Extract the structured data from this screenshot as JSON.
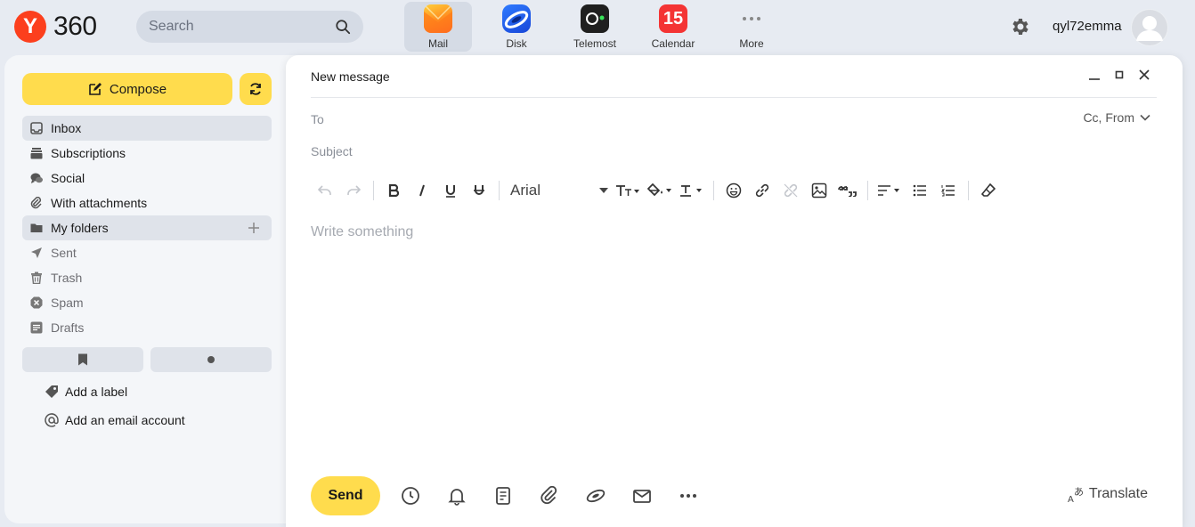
{
  "brand": {
    "logo_letter": "Y",
    "logo_text": "360"
  },
  "search": {
    "placeholder": "Search"
  },
  "apps": [
    {
      "label": "Mail"
    },
    {
      "label": "Disk"
    },
    {
      "label": "Telemost"
    },
    {
      "label": "Calendar",
      "badge": "15"
    },
    {
      "label": "More"
    }
  ],
  "user": {
    "name": "qyl72emma"
  },
  "sidebar": {
    "compose_label": "Compose",
    "folders": [
      {
        "label": "Inbox"
      },
      {
        "label": "Subscriptions"
      },
      {
        "label": "Social"
      },
      {
        "label": "With attachments"
      },
      {
        "label": "My folders"
      },
      {
        "label": "Sent"
      },
      {
        "label": "Trash"
      },
      {
        "label": "Spam"
      },
      {
        "label": "Drafts"
      }
    ],
    "add_label": "Add a label",
    "add_account": "Add an email account"
  },
  "compose": {
    "title": "New message",
    "to_placeholder": "To",
    "cc_from": "Cc, From",
    "subject_placeholder": "Subject",
    "font": "Arial",
    "body_placeholder": "Write something",
    "send_label": "Send",
    "translate_label": "Translate"
  },
  "colors": {
    "accent_yellow": "#ffdc4d",
    "brand_red": "#fc3f1d",
    "page_bg": "#e7ebf2",
    "sidebar_bg": "#f4f6f9"
  }
}
